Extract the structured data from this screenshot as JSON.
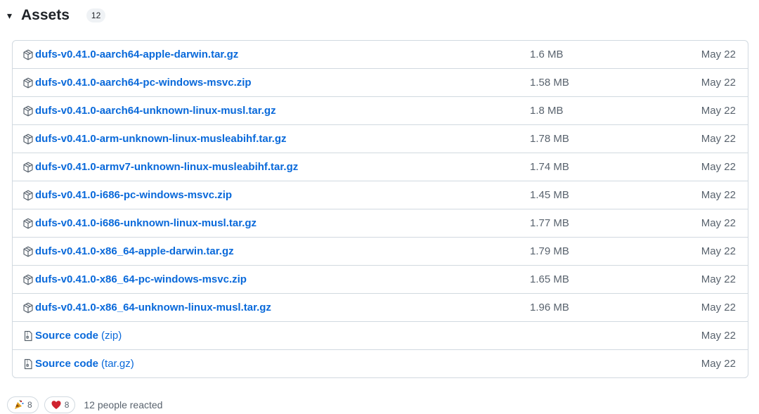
{
  "header": {
    "caret": "▾",
    "title": "Assets",
    "count": "12"
  },
  "assets": [
    {
      "name": "dufs-v0.41.0-aarch64-apple-darwin.tar.gz",
      "size": "1.6 MB",
      "date": "May 22",
      "icon": "package-icon"
    },
    {
      "name": "dufs-v0.41.0-aarch64-pc-windows-msvc.zip",
      "size": "1.58 MB",
      "date": "May 22",
      "icon": "package-icon"
    },
    {
      "name": "dufs-v0.41.0-aarch64-unknown-linux-musl.tar.gz",
      "size": "1.8 MB",
      "date": "May 22",
      "icon": "package-icon"
    },
    {
      "name": "dufs-v0.41.0-arm-unknown-linux-musleabihf.tar.gz",
      "size": "1.78 MB",
      "date": "May 22",
      "icon": "package-icon"
    },
    {
      "name": "dufs-v0.41.0-armv7-unknown-linux-musleabihf.tar.gz",
      "size": "1.74 MB",
      "date": "May 22",
      "icon": "package-icon"
    },
    {
      "name": "dufs-v0.41.0-i686-pc-windows-msvc.zip",
      "size": "1.45 MB",
      "date": "May 22",
      "icon": "package-icon"
    },
    {
      "name": "dufs-v0.41.0-i686-unknown-linux-musl.tar.gz",
      "size": "1.77 MB",
      "date": "May 22",
      "icon": "package-icon"
    },
    {
      "name": "dufs-v0.41.0-x86_64-apple-darwin.tar.gz",
      "size": "1.79 MB",
      "date": "May 22",
      "icon": "package-icon"
    },
    {
      "name": "dufs-v0.41.0-x86_64-pc-windows-msvc.zip",
      "size": "1.65 MB",
      "date": "May 22",
      "icon": "package-icon"
    },
    {
      "name": "dufs-v0.41.0-x86_64-unknown-linux-musl.tar.gz",
      "size": "1.96 MB",
      "date": "May 22",
      "icon": "package-icon"
    },
    {
      "name": "Source code",
      "suffix": "(zip)",
      "size": "",
      "date": "May 22",
      "icon": "file-zip-icon"
    },
    {
      "name": "Source code",
      "suffix": "(tar.gz)",
      "size": "",
      "date": "May 22",
      "icon": "file-zip-icon"
    }
  ],
  "reactions": {
    "items": [
      {
        "emoji": "🎉",
        "icon": "tada-icon",
        "count": "8"
      },
      {
        "emoji": "❤",
        "icon": "heart-icon",
        "count": "8"
      }
    ],
    "summary": "12 people reacted"
  },
  "colors": {
    "link": "#0969da",
    "muted": "#59636e",
    "border": "#d1d9e0",
    "heart": "#cf222e"
  }
}
